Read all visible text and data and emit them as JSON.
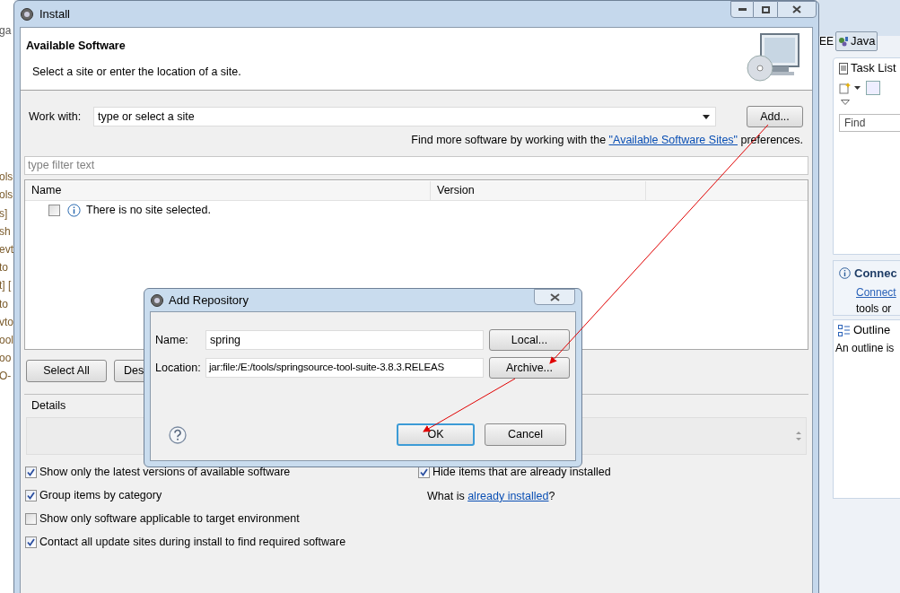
{
  "background_ide": {
    "left_fragments": [
      "ga",
      "ols",
      "ols",
      "s]",
      "sh",
      "evt",
      "to",
      "t] [",
      "to",
      "vto",
      "ool",
      "oo",
      "O-"
    ],
    "perspective_prefix": "EE",
    "perspective_button": {
      "label": "Java",
      "selected": true
    },
    "task_list": {
      "title": "Task List",
      "find_placeholder": "Find"
    },
    "connect": {
      "title": "Connec",
      "link": "Connect",
      "text": "tools or"
    },
    "outline": {
      "title": "Outline",
      "text": "An outline is"
    }
  },
  "install_window": {
    "title": "Install",
    "header": {
      "title": "Available Software",
      "subtitle": "Select a site or enter the location of a site."
    },
    "work_with": {
      "label": "Work with:",
      "value": "type or select a site",
      "add_button": "Add..."
    },
    "find_more": {
      "before": "Find more software by working with the ",
      "link": "\"Available Software Sites\"",
      "after": " preferences."
    },
    "filter": {
      "placeholder": "type filter text"
    },
    "table": {
      "columns": [
        "Name",
        "Version"
      ],
      "rows": [
        {
          "checked": false,
          "text": "There is no site selected."
        }
      ]
    },
    "buttons": [
      "Select All",
      "Des"
    ],
    "details": {
      "label": "Details"
    },
    "options_left": [
      {
        "label": "Show only the latest versions of available software",
        "checked": true
      },
      {
        "label": "Group items by category",
        "checked": true
      },
      {
        "label": "Show only software applicable to target environment",
        "checked": false
      },
      {
        "label": "Contact all update sites during install to find required software",
        "checked": true
      }
    ],
    "options_right": [
      {
        "label": "Hide items that are already installed",
        "checked": true
      }
    ],
    "installed_note": {
      "before": "What is ",
      "link": "already installed",
      "after": "?"
    }
  },
  "add_repository": {
    "title": "Add Repository",
    "name": {
      "label": "Name:",
      "value": "spring"
    },
    "location": {
      "label": "Location:",
      "value": "jar:file:/E:/tools/springsource-tool-suite-3.8.3.RELEAS"
    },
    "side_buttons": [
      "Local...",
      "Archive..."
    ],
    "ok": "OK",
    "cancel": "Cancel"
  }
}
